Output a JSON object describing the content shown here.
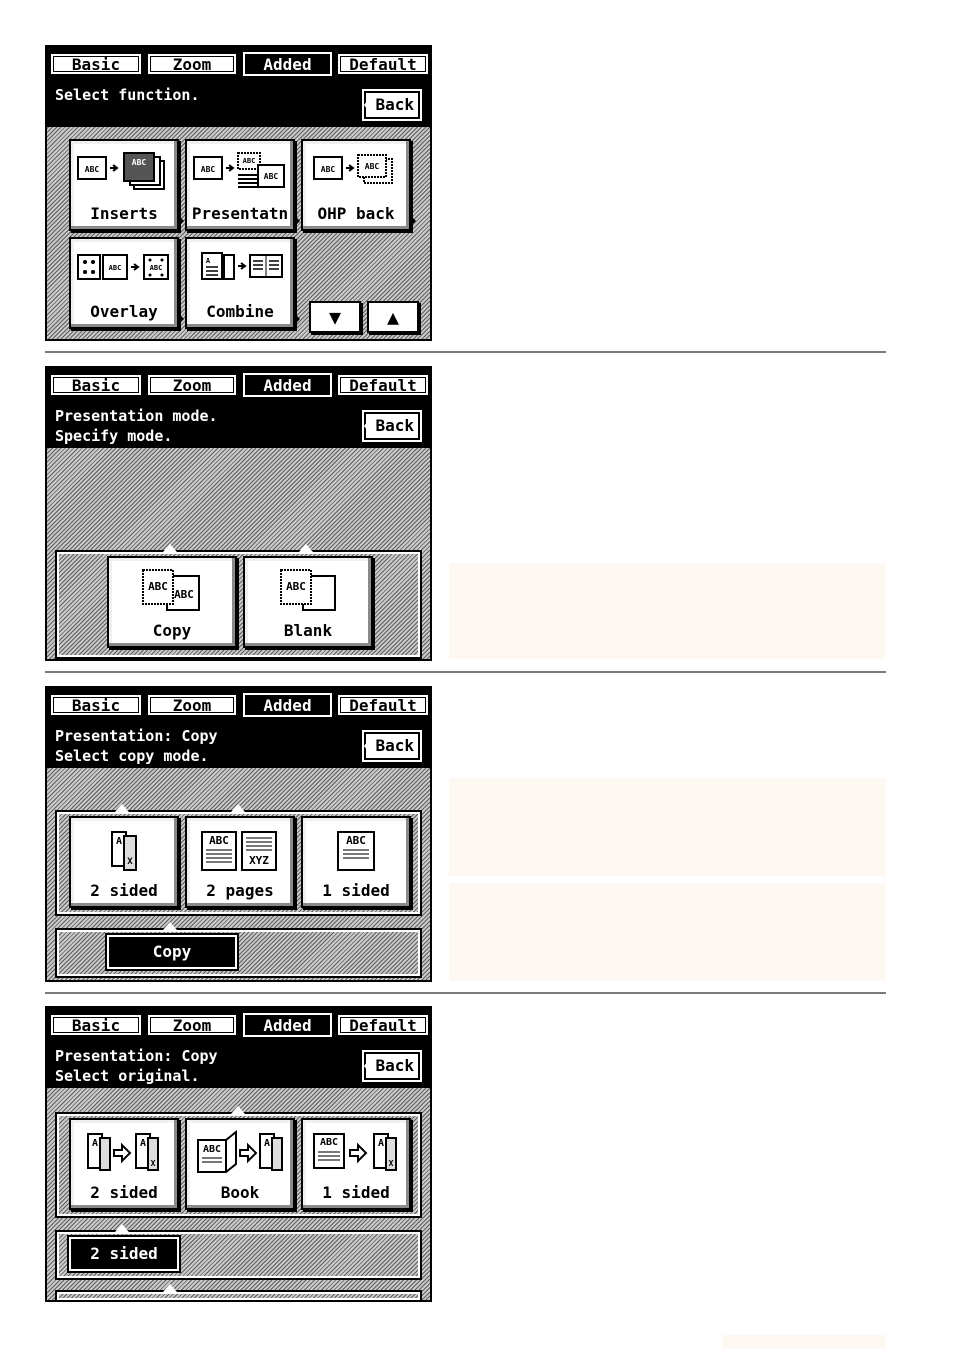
{
  "tabs": [
    "Basic",
    "Zoom",
    "Added",
    "Default"
  ],
  "active_tab": "Added",
  "back_label": "Back",
  "screen1": {
    "message": "Select function.",
    "buttons": [
      {
        "label": "Inserts",
        "icon": "inserts-icon"
      },
      {
        "label": "Presentatn",
        "icon": "presentation-icon"
      },
      {
        "label": "OHP back",
        "icon": "ohp-back-icon"
      },
      {
        "label": "Overlay",
        "icon": "overlay-icon"
      },
      {
        "label": "Combine",
        "icon": "combine-icon"
      }
    ],
    "arrows": [
      "▼",
      "▲"
    ]
  },
  "screen2": {
    "message_line1": "Presentation mode.",
    "message_line2": "Specify mode.",
    "buttons": [
      {
        "label": "Copy",
        "icon": "copy-mode-icon"
      },
      {
        "label": "Blank",
        "icon": "blank-mode-icon"
      }
    ]
  },
  "screen3": {
    "message_line1": "Presentation: Copy",
    "message_line2": "Select copy mode.",
    "buttons": [
      {
        "label": "2 sided",
        "icon": "two-sided-icon"
      },
      {
        "label": "2 pages",
        "icon": "two-pages-icon"
      },
      {
        "label": "1 sided",
        "icon": "one-sided-icon"
      }
    ],
    "selected": "Copy"
  },
  "screen4": {
    "message_line1": "Presentation: Copy",
    "message_line2": "Select original.",
    "buttons": [
      {
        "label": "2 sided",
        "icon": "two-sided-original-icon"
      },
      {
        "label": "Book",
        "icon": "book-original-icon"
      },
      {
        "label": "1 sided",
        "icon": "one-sided-original-icon"
      }
    ],
    "selected": "2 sided"
  },
  "colors": {
    "panel_bg": "#c9c9c9",
    "bar": "#000000",
    "note_bg": "#fdf8f1"
  }
}
